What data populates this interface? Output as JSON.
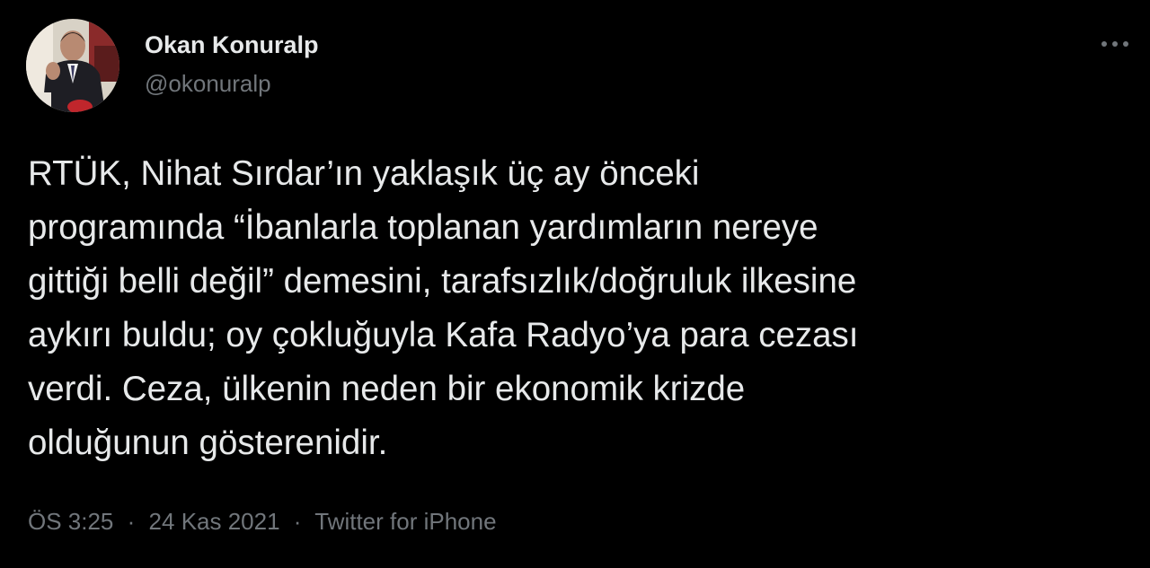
{
  "user": {
    "display_name": "Okan Konuralp",
    "handle": "@okonuralp"
  },
  "tweet": {
    "lines": [
      "RTÜK, Nihat Sırdar’ın yaklaşık üç ay önceki",
      "programında “İbanlarla toplanan yardımların nereye",
      "gittiği belli değil” demesini, tarafsızlık/doğruluk ilkesine",
      "aykırı buldu; oy çokluğuyla Kafa Radyo’ya para cezası",
      "verdi. Ceza, ülkenin neden bir ekonomik krizde",
      "olduğunun gösterenidir."
    ]
  },
  "meta": {
    "time": "ÖS 3:25",
    "separator": "·",
    "date": "24 Kas 2021",
    "source": "Twitter for iPhone"
  },
  "icons": {
    "more": "more-horizontal-icon"
  },
  "colors": {
    "background": "#000000",
    "primary_text": "#e7e9ea",
    "secondary_text": "#71767b"
  }
}
